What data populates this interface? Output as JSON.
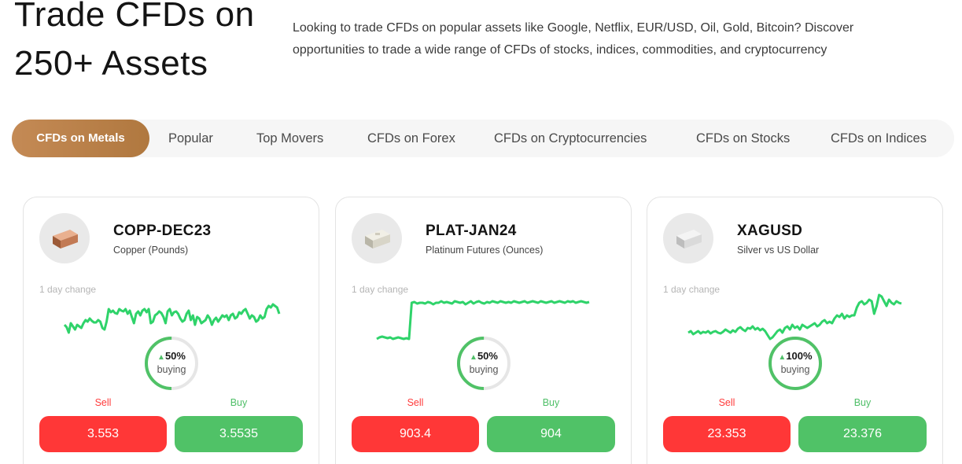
{
  "hero": {
    "title": "Trade CFDs on 250+ Assets",
    "description": "Looking to trade CFDs on popular assets like Google, Netflix, EUR/USD, Oil, Gold, Bitcoin? Discover opportunities to trade a wide range of CFDs of stocks, indices, commodities, and cryptocurrency"
  },
  "tabs": [
    {
      "label": "CFDs on Metals",
      "active": true
    },
    {
      "label": "Popular"
    },
    {
      "label": "Top Movers"
    },
    {
      "label": "CFDs on Forex"
    },
    {
      "label": "CFDs on Cryptocurrencies"
    },
    {
      "label": "CFDs on Stocks"
    },
    {
      "label": "CFDs on Indices"
    }
  ],
  "colors": {
    "accent": "#b8804a",
    "sell": "#ff3737",
    "buy": "#50c267",
    "chart": "#2fd36a"
  },
  "cards": [
    {
      "name": "COPP-DEC23",
      "subtitle": "Copper (Pounds)",
      "icon": "copper-bar-icon",
      "change_label": "1 day change",
      "buying_pct": "50%",
      "buying_value": 0.5,
      "buying_label": "buying",
      "sell_label": "Sell",
      "buy_label": "Buy",
      "sell_price": "3.553",
      "buy_price": "3.5535",
      "spark": [
        42,
        45,
        52,
        40,
        44,
        48,
        42,
        44,
        46,
        40,
        36,
        38,
        34,
        37,
        39,
        39,
        36,
        38,
        46,
        48,
        38,
        22,
        26,
        24,
        27,
        28,
        22,
        24,
        25,
        22,
        28,
        24,
        32,
        40,
        28,
        25,
        30,
        24,
        22,
        26,
        22,
        40,
        38,
        30,
        28,
        25,
        27,
        32,
        40,
        25,
        22,
        30,
        26,
        25,
        28,
        34,
        38,
        36,
        28,
        24,
        36,
        30,
        42,
        32,
        34,
        40,
        38,
        36,
        30,
        34,
        42,
        36,
        33,
        38,
        34,
        30,
        32,
        30,
        36,
        30,
        28,
        34,
        32,
        26,
        28,
        24,
        22,
        28,
        34,
        30,
        32,
        38,
        36,
        30,
        34,
        32,
        22,
        18,
        20,
        16,
        18,
        20,
        28
      ]
    },
    {
      "name": "PLAT-JAN24",
      "subtitle": "Platinum Futures (Ounces)",
      "icon": "platinum-bar-icon",
      "change_label": "1 day change",
      "buying_pct": "50%",
      "buying_value": 0.5,
      "buying_label": "buying",
      "sell_label": "Sell",
      "buy_label": "Buy",
      "sell_price": "903.4",
      "buy_price": "904",
      "spark": [
        60,
        58,
        57,
        58,
        59,
        58,
        60,
        59,
        58,
        59,
        60,
        59,
        60,
        14,
        13,
        15,
        14,
        14,
        15,
        13,
        14,
        16,
        14,
        14,
        12,
        14,
        13,
        14,
        15,
        12,
        13,
        14,
        13,
        16,
        14,
        12,
        15,
        13,
        12,
        14,
        15,
        13,
        14,
        12,
        13,
        14,
        12,
        13,
        14,
        13,
        14,
        12,
        13,
        14,
        13,
        12,
        14,
        13,
        12,
        13,
        14,
        12,
        13,
        14,
        13,
        12,
        14,
        13,
        12,
        13,
        14,
        12,
        13,
        12,
        14,
        13,
        12,
        13,
        14,
        13
      ]
    },
    {
      "name": "XAGUSD",
      "subtitle": "Silver vs US Dollar",
      "icon": "silver-bar-icon",
      "change_label": "1 day change",
      "buying_pct": "100%",
      "buying_value": 1.0,
      "buying_label": "buying",
      "sell_label": "Sell",
      "buy_label": "Buy",
      "sell_price": "23.353",
      "buy_price": "23.376",
      "spark": [
        52,
        50,
        54,
        52,
        50,
        53,
        51,
        52,
        50,
        53,
        51,
        50,
        52,
        53,
        51,
        48,
        50,
        52,
        49,
        51,
        47,
        45,
        48,
        50,
        46,
        47,
        44,
        48,
        46,
        49,
        47,
        50,
        55,
        60,
        58,
        54,
        50,
        48,
        52,
        46,
        44,
        48,
        42,
        46,
        44,
        48,
        42,
        44,
        46,
        44,
        42,
        40,
        44,
        42,
        38,
        36,
        40,
        38,
        40,
        34,
        30,
        32,
        28,
        34,
        30,
        32,
        30,
        30,
        20,
        14,
        12,
        16,
        14,
        10,
        12,
        28,
        18,
        4,
        6,
        12,
        18,
        10,
        14,
        16,
        12,
        14,
        15
      ]
    }
  ]
}
